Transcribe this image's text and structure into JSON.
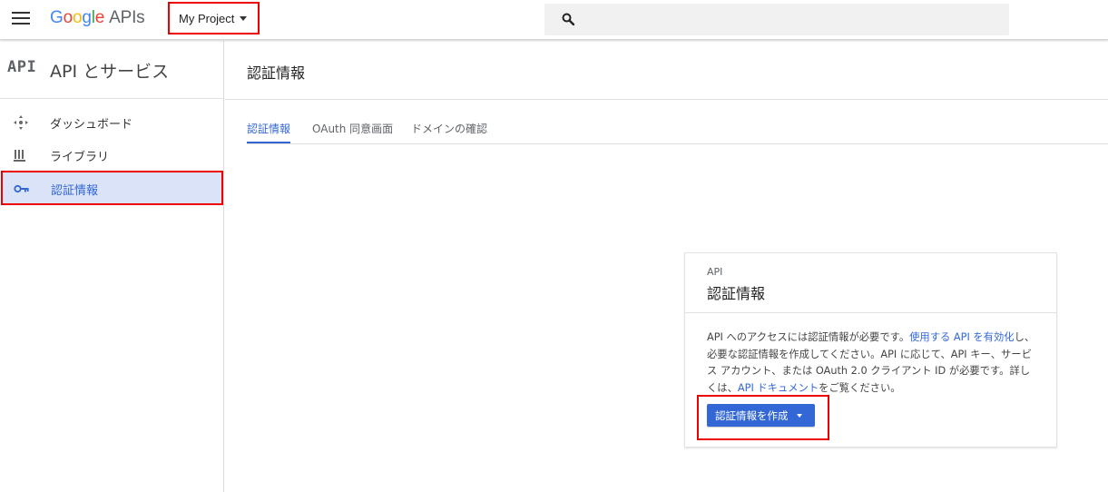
{
  "header": {
    "logo_google": [
      "G",
      "o",
      "o",
      "g",
      "l",
      "e"
    ],
    "logo_apis": "APIs",
    "project_name": "My Project",
    "search_placeholder": ""
  },
  "sidebar": {
    "logo": "API",
    "title": "API とサービス",
    "items": [
      {
        "label": "ダッシュボード",
        "icon": "dashboard-icon",
        "active": false
      },
      {
        "label": "ライブラリ",
        "icon": "library-icon",
        "active": false
      },
      {
        "label": "認証情報",
        "icon": "key-icon",
        "active": true
      }
    ]
  },
  "main": {
    "title": "認証情報",
    "tabs": [
      {
        "label": "認証情報",
        "active": true
      },
      {
        "label": "OAuth 同意画面",
        "active": false
      },
      {
        "label": "ドメインの確認",
        "active": false
      }
    ]
  },
  "card": {
    "kicker": "API",
    "title": "認証情報",
    "body_part1": "API へのアクセスには認証情報が必要です。",
    "body_link1": "使用する API を有効化",
    "body_part2": "し、必要な認証情報を作成してください。API に応じて、API キー、サービス アカウント、または OAuth 2.0 クライアント ID が必要です。詳しくは、",
    "body_link2": "API ドキュメント",
    "body_part3": "をご覧ください。",
    "create_button": "認証情報を作成"
  },
  "colors": {
    "accent": "#3367d6",
    "highlight_border": "#ee0000",
    "active_item_bg": "#dae3f8"
  }
}
